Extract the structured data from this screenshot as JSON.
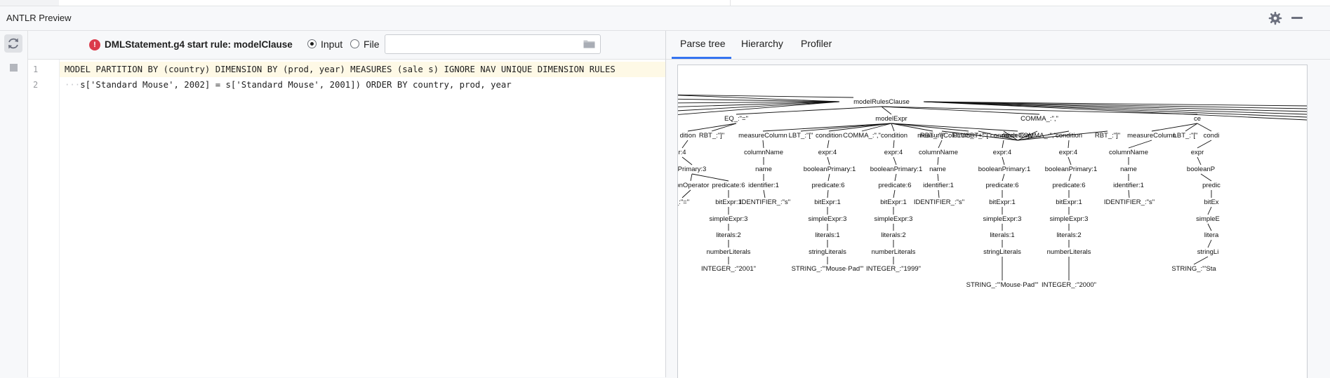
{
  "window": {
    "title": "ANTLR Preview"
  },
  "editor_toolbar": {
    "grammar_label": "DMLStatement.g4 start rule: modelClause",
    "input_label": "Input",
    "file_label": "File",
    "file_path_value": ""
  },
  "editor": {
    "line_numbers": [
      "1",
      "2"
    ],
    "lines": [
      "MODEL PARTITION BY (country) DIMENSION BY (prod, year) MEASURES (sale s) IGNORE NAV UNIQUE DIMENSION RULES",
      "s['Standard Mouse', 2002] = s['Standard Mouse', 2001]) ORDER BY country, prod, year"
    ],
    "line2_indent": "···"
  },
  "tabs": [
    {
      "label": "Parse tree",
      "active": true
    },
    {
      "label": "Hierarchy",
      "active": false
    },
    {
      "label": "Profiler",
      "active": false
    }
  ],
  "colors": {
    "accent": "#3574f0",
    "error": "#db3b4b",
    "current_line": "#fef9e6"
  },
  "icons": [
    "refresh-icon",
    "stop-icon",
    "gear-icon",
    "minimize-icon",
    "error-icon",
    "folder-icon"
  ],
  "parse_tree": {
    "nodes": [
      {
        "id": "mrc",
        "label": "modelRulesClause"
      },
      {
        "id": "eq",
        "label": "EQ_:\"=\""
      },
      {
        "id": "mx",
        "label": "modelExpr"
      },
      {
        "id": "cm",
        "label": "COMMA_:\",\""
      },
      {
        "id": "ce",
        "label": "ce"
      },
      {
        "id": "cL",
        "label": "dition"
      },
      {
        "id": "rbL",
        "label": "RBT_:\"]\""
      },
      {
        "id": "r4",
        "label": "r:4"
      },
      {
        "id": "pr3",
        "label": "Primary:3"
      },
      {
        "id": "co",
        "label": "sonOperator"
      },
      {
        "id": "p6a",
        "label": "predicate:6"
      },
      {
        "id": "eqs",
        "label": "_:\"=\""
      },
      {
        "id": "be1a",
        "label": "bitExpr:1"
      },
      {
        "id": "se3a",
        "label": "simpleExpr:3"
      },
      {
        "id": "l2a",
        "label": "literals:2"
      },
      {
        "id": "nla",
        "label": "numberLiterals"
      },
      {
        "id": "i2001",
        "label": "INTEGER_:\"2001\""
      },
      {
        "id": "mc1",
        "label": "measureColumn"
      },
      {
        "id": "lbt1",
        "label": "LBT_:\"[\""
      },
      {
        "id": "c1",
        "label": "condition"
      },
      {
        "id": "cm1",
        "label": "COMMA_:\",\""
      },
      {
        "id": "c2",
        "label": "condition"
      },
      {
        "id": "rbt1",
        "label": "RBT_:\"]\""
      },
      {
        "id": "pl",
        "label": "PLUS_:\"+\""
      },
      {
        "id": "mx2",
        "label": "modelExpr"
      },
      {
        "id": "cn1",
        "label": "columnName"
      },
      {
        "id": "e4a",
        "label": "expr:4"
      },
      {
        "id": "e4b",
        "label": "expr:4"
      },
      {
        "id": "nm1",
        "label": "name"
      },
      {
        "id": "bp1a",
        "label": "booleanPrimary:1"
      },
      {
        "id": "bp1b",
        "label": "booleanPrimary:1"
      },
      {
        "id": "id1",
        "label": "identifier:1"
      },
      {
        "id": "p6b",
        "label": "predicate:6"
      },
      {
        "id": "p6c",
        "label": "predicate:6"
      },
      {
        "id": "ids1",
        "label": "IDENTIFIER_:\"s\""
      },
      {
        "id": "be1b",
        "label": "bitExpr:1"
      },
      {
        "id": "be1c",
        "label": "bitExpr:1"
      },
      {
        "id": "se3b",
        "label": "simpleExpr:3"
      },
      {
        "id": "se3c",
        "label": "simpleExpr:3"
      },
      {
        "id": "l1b",
        "label": "literals:1"
      },
      {
        "id": "l2c",
        "label": "literals:2"
      },
      {
        "id": "slb",
        "label": "stringLiterals"
      },
      {
        "id": "nlc",
        "label": "numberLiterals"
      },
      {
        "id": "smp",
        "label": "STRING_:\"'Mouse·Pad'\""
      },
      {
        "id": "i1999",
        "label": "INTEGER_:\"1999\""
      },
      {
        "id": "mc2",
        "label": "measureColumn"
      },
      {
        "id": "lbt2",
        "label": "LBT_:\"[\""
      },
      {
        "id": "c3",
        "label": "condition"
      },
      {
        "id": "cm2",
        "label": "COMMA_:\",\""
      },
      {
        "id": "c4",
        "label": "condition"
      },
      {
        "id": "rbt2",
        "label": "RBT_:\"]\""
      },
      {
        "id": "cn2",
        "label": "columnName"
      },
      {
        "id": "e4c",
        "label": "expr:4"
      },
      {
        "id": "e4d",
        "label": "expr:4"
      },
      {
        "id": "nm2",
        "label": "name"
      },
      {
        "id": "bp1c",
        "label": "booleanPrimary:1"
      },
      {
        "id": "bp1d",
        "label": "booleanPrimary:1"
      },
      {
        "id": "id2",
        "label": "identifier:1"
      },
      {
        "id": "p6d",
        "label": "predicate:6"
      },
      {
        "id": "p6e",
        "label": "predicate:6"
      },
      {
        "id": "ids2",
        "label": "IDENTIFIER_:\"s\""
      },
      {
        "id": "be1d",
        "label": "bitExpr:1"
      },
      {
        "id": "be1e",
        "label": "bitExpr:1"
      },
      {
        "id": "se3d",
        "label": "simpleExpr:3"
      },
      {
        "id": "se3e",
        "label": "simpleExpr:3"
      },
      {
        "id": "l1d",
        "label": "literals:1"
      },
      {
        "id": "l2e",
        "label": "literals:2"
      },
      {
        "id": "sld",
        "label": "stringLiterals"
      },
      {
        "id": "nle",
        "label": "numberLiterals"
      },
      {
        "id": "smp2",
        "label": "STRING_:\"'Mouse·Pad'\""
      },
      {
        "id": "i2000",
        "label": "INTEGER_:\"2000\""
      },
      {
        "id": "mc3",
        "label": "measureColumn"
      },
      {
        "id": "lbt3",
        "label": "LBT_:\"[\""
      },
      {
        "id": "cR",
        "label": "condi"
      },
      {
        "id": "cn3",
        "label": "columnName"
      },
      {
        "id": "expR",
        "label": "expr"
      },
      {
        "id": "nm3",
        "label": "name"
      },
      {
        "id": "bpR",
        "label": "booleanP"
      },
      {
        "id": "id3",
        "label": "identifier:1"
      },
      {
        "id": "prR",
        "label": "predic"
      },
      {
        "id": "ids3",
        "label": "IDENTIFIER_:\"s\""
      },
      {
        "id": "beR",
        "label": "bitEx"
      },
      {
        "id": "seR",
        "label": "simpleE"
      },
      {
        "id": "liR",
        "label": "litera"
      },
      {
        "id": "slR",
        "label": "stringLi"
      },
      {
        "id": "stR",
        "label": "STRING_:\"'Sta"
      }
    ]
  }
}
